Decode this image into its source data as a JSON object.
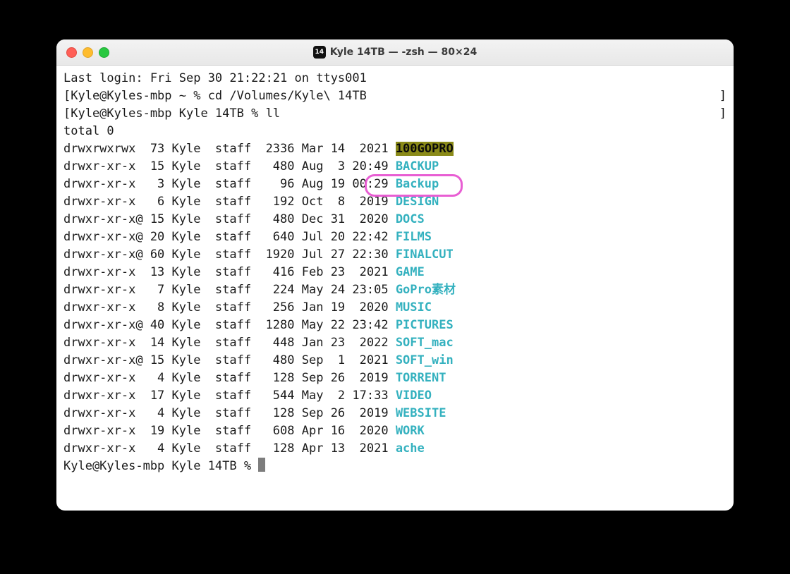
{
  "window": {
    "title": "Kyle 14TB — -zsh — 80×24",
    "icon_label": "14"
  },
  "login_line": "Last login: Fri Sep 30 21:22:21 on ttys001",
  "prompt1_lbracket": "[",
  "prompt1": "Kyle@Kyles-mbp ~ % cd /Volumes/Kyle\\ 14TB",
  "prompt1_rbracket": "]",
  "prompt2_lbracket": "[",
  "prompt2": "Kyle@Kyles-mbp Kyle 14TB % ll",
  "prompt2_rbracket": "]",
  "total_line": "total 0",
  "prompt3": "Kyle@Kyles-mbp Kyle 14TB % ",
  "listing": [
    {
      "perm": "drwxrwxrwx ",
      "links": "73",
      "owner": "Kyle",
      "group": "staff",
      "size": "2336",
      "date": "Mar 14  2021",
      "name": "100GOPRO",
      "hl": "green"
    },
    {
      "perm": "drwxr-xr-x ",
      "links": "15",
      "owner": "Kyle",
      "group": "staff",
      "size": "480",
      "date": "Aug  3 20:49",
      "name": "BACKUP"
    },
    {
      "perm": "drwxr-xr-x ",
      "links": "3",
      "owner": "Kyle",
      "group": "staff",
      "size": "96",
      "date": "Aug 19 00:29",
      "name": "Backup",
      "annot": true
    },
    {
      "perm": "drwxr-xr-x ",
      "links": "6",
      "owner": "Kyle",
      "group": "staff",
      "size": "192",
      "date": "Oct  8  2019",
      "name": "DESIGN"
    },
    {
      "perm": "drwxr-xr-x@",
      "links": "15",
      "owner": "Kyle",
      "group": "staff",
      "size": "480",
      "date": "Dec 31  2020",
      "name": "DOCS"
    },
    {
      "perm": "drwxr-xr-x@",
      "links": "20",
      "owner": "Kyle",
      "group": "staff",
      "size": "640",
      "date": "Jul 20 22:42",
      "name": "FILMS"
    },
    {
      "perm": "drwxr-xr-x@",
      "links": "60",
      "owner": "Kyle",
      "group": "staff",
      "size": "1920",
      "date": "Jul 27 22:30",
      "name": "FINALCUT"
    },
    {
      "perm": "drwxr-xr-x ",
      "links": "13",
      "owner": "Kyle",
      "group": "staff",
      "size": "416",
      "date": "Feb 23  2021",
      "name": "GAME"
    },
    {
      "perm": "drwxr-xr-x ",
      "links": "7",
      "owner": "Kyle",
      "group": "staff",
      "size": "224",
      "date": "May 24 23:05",
      "name": "GoPro素材"
    },
    {
      "perm": "drwxr-xr-x ",
      "links": "8",
      "owner": "Kyle",
      "group": "staff",
      "size": "256",
      "date": "Jan 19  2020",
      "name": "MUSIC"
    },
    {
      "perm": "drwxr-xr-x@",
      "links": "40",
      "owner": "Kyle",
      "group": "staff",
      "size": "1280",
      "date": "May 22 23:42",
      "name": "PICTURES"
    },
    {
      "perm": "drwxr-xr-x ",
      "links": "14",
      "owner": "Kyle",
      "group": "staff",
      "size": "448",
      "date": "Jan 23  2022",
      "name": "SOFT_mac"
    },
    {
      "perm": "drwxr-xr-x@",
      "links": "15",
      "owner": "Kyle",
      "group": "staff",
      "size": "480",
      "date": "Sep  1  2021",
      "name": "SOFT_win"
    },
    {
      "perm": "drwxr-xr-x ",
      "links": "4",
      "owner": "Kyle",
      "group": "staff",
      "size": "128",
      "date": "Sep 26  2019",
      "name": "TORRENT"
    },
    {
      "perm": "drwxr-xr-x ",
      "links": "17",
      "owner": "Kyle",
      "group": "staff",
      "size": "544",
      "date": "May  2 17:33",
      "name": "VIDEO"
    },
    {
      "perm": "drwxr-xr-x ",
      "links": "4",
      "owner": "Kyle",
      "group": "staff",
      "size": "128",
      "date": "Sep 26  2019",
      "name": "WEBSITE"
    },
    {
      "perm": "drwxr-xr-x ",
      "links": "19",
      "owner": "Kyle",
      "group": "staff",
      "size": "608",
      "date": "Apr 16  2020",
      "name": "WORK"
    },
    {
      "perm": "drwxr-xr-x ",
      "links": "4",
      "owner": "Kyle",
      "group": "staff",
      "size": "128",
      "date": "Apr 13  2021",
      "name": "ache"
    }
  ]
}
